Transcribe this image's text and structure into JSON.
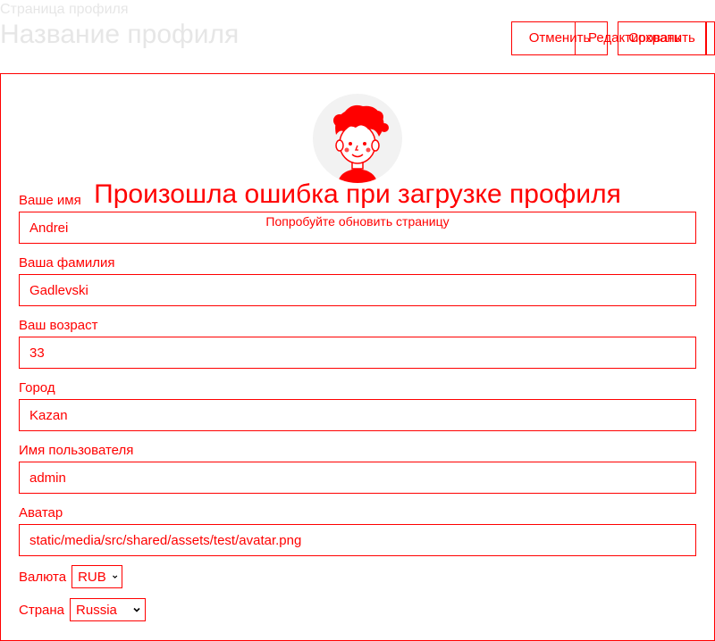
{
  "header": {
    "page_label": "Страница профиля",
    "profile_title": "Название профиля",
    "buttons": {
      "cancel": "Отменить",
      "edit": "Редактировать",
      "save": "Сохранить"
    }
  },
  "error": {
    "title": "Произошла ошибка при загрузке профиля",
    "subtitle": "Попробуйте обновить страницу"
  },
  "form": {
    "first_name": {
      "label": "Ваше имя",
      "value": "Andrei"
    },
    "last_name": {
      "label": "Ваша фамилия",
      "value": "Gadlevski"
    },
    "age": {
      "label": "Ваш возраст",
      "value": "33"
    },
    "city": {
      "label": "Город",
      "value": "Kazan"
    },
    "username": {
      "label": "Имя пользователя",
      "value": "admin"
    },
    "avatar": {
      "label": "Аватар",
      "value": "static/media/src/shared/assets/test/avatar.png"
    },
    "currency": {
      "label": "Валюта",
      "selected": "RUB"
    },
    "country": {
      "label": "Страна",
      "selected": "Russia"
    }
  },
  "colors": {
    "accent": "#ff0000",
    "muted_text": "#e6e6e6",
    "avatar_bg": "#f2f2f2"
  },
  "icons": {
    "avatar": "cartoon-person-avatar",
    "select": "chevron-down-icon"
  }
}
